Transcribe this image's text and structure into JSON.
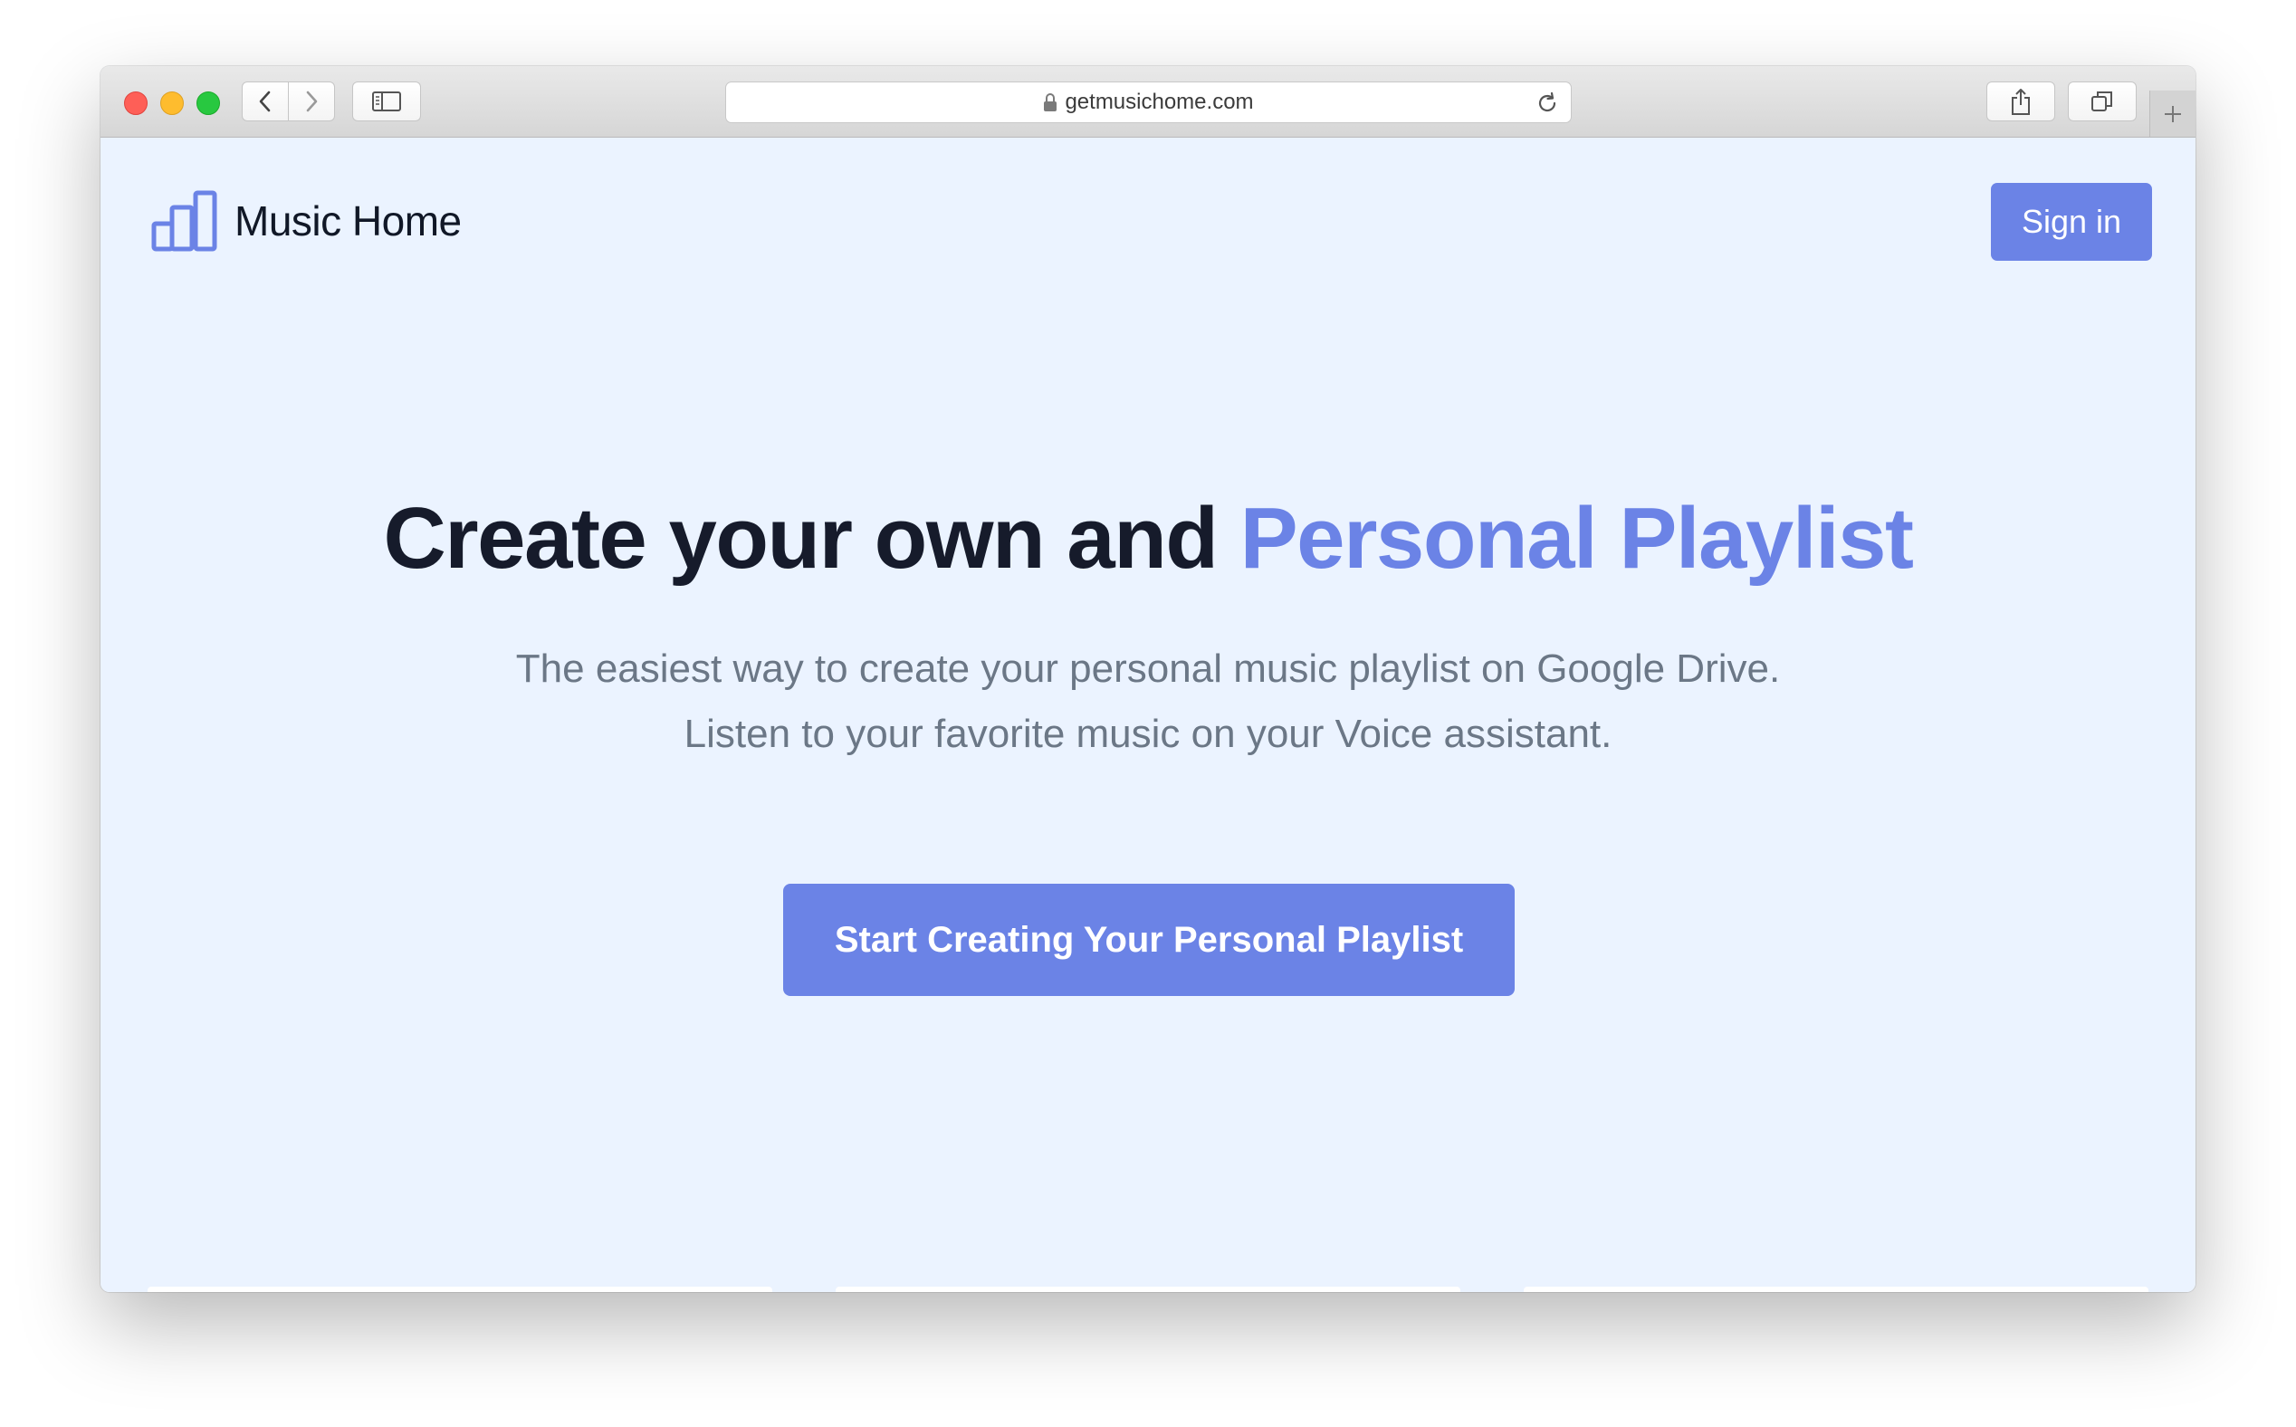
{
  "browser": {
    "url": "getmusichome.com"
  },
  "header": {
    "brand": "Music Home",
    "signin_label": "Sign in"
  },
  "hero": {
    "title_plain": "Create your own and ",
    "title_accent": "Personal Playlist",
    "subtitle_line1": "The easiest way to create your personal music playlist on Google Drive.",
    "subtitle_line2": "Listen to your favorite music on your Voice assistant.",
    "cta_label": "Start Creating Your Personal Playlist"
  },
  "colors": {
    "accent": "#6b83e6",
    "page_background": "#ebf3ff",
    "heading": "#161b2b",
    "subtitle": "#6b7786"
  },
  "icons": [
    "back-icon",
    "forward-icon",
    "sidebar-icon",
    "lock-icon",
    "reload-icon",
    "share-icon",
    "tabs-icon",
    "plus-icon",
    "bar-chart-logo-icon"
  ]
}
